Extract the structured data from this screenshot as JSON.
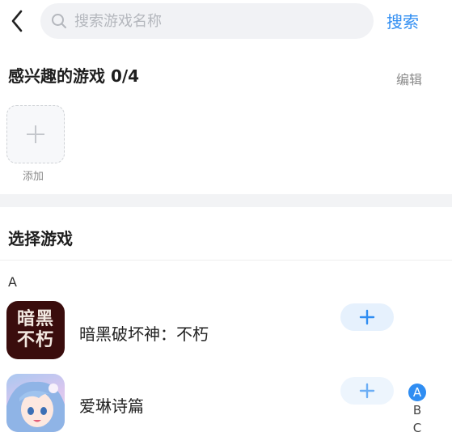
{
  "header": {
    "search_placeholder": "搜索游戏名称",
    "search_label": "搜索",
    "icons": [
      "back-arrow-icon",
      "search-icon"
    ]
  },
  "favorites": {
    "title": "感兴趣的游戏 0/4",
    "edit_label": "编辑",
    "add_label": "添加"
  },
  "choose": {
    "title": "选择游戏",
    "section_letter": "A",
    "games": [
      {
        "name": "暗黑破坏神：不朽",
        "icon_text_top": "暗黑",
        "icon_text_bottom": "不朽"
      },
      {
        "name": "爱琳诗篇"
      }
    ]
  },
  "index_bar": [
    "A",
    "B",
    "C"
  ],
  "colors": {
    "accent": "#2f8df2",
    "pill_bg": "#e6f1fd"
  }
}
